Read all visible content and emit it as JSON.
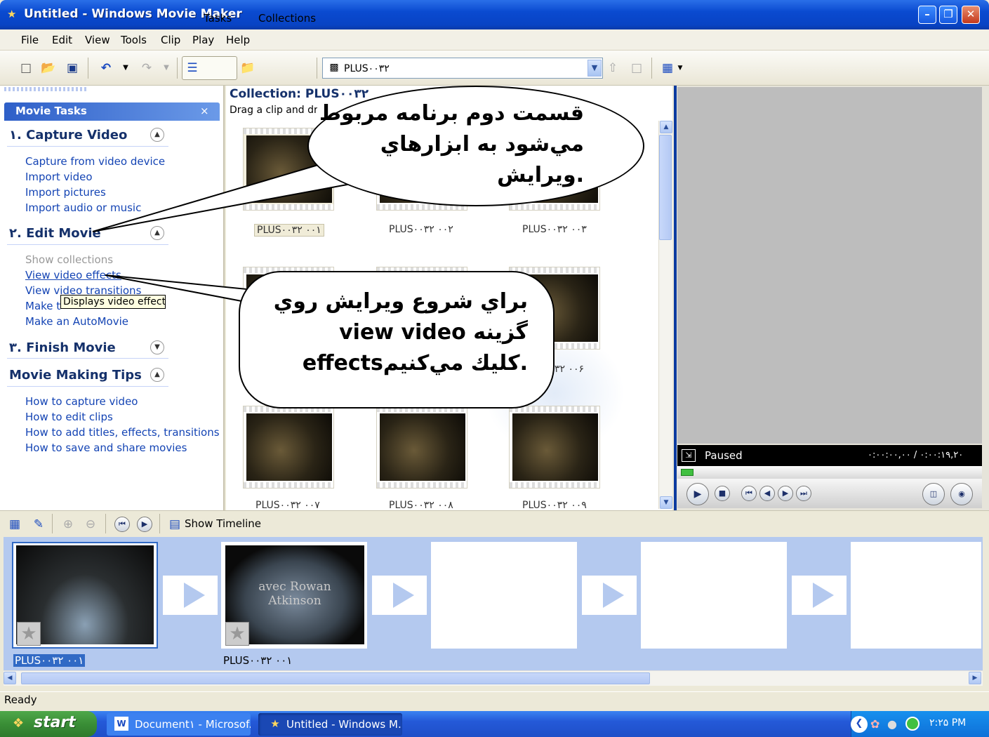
{
  "window": {
    "title": "Untitled - Windows Movie Maker",
    "min": "–",
    "max": "❐",
    "close": "✕"
  },
  "menu": [
    "File",
    "Edit",
    "View",
    "Tools",
    "Clip",
    "Play",
    "Help"
  ],
  "toolbar": {
    "tasks": "Tasks",
    "collections": "Collections",
    "collection_value": "PLUS۰۰۳۲"
  },
  "taskpane": {
    "header": "Movie Tasks",
    "close": "×",
    "sections": [
      {
        "title": "۱. Capture Video",
        "links": [
          "Capture from video device",
          "Import video",
          "Import pictures",
          "Import audio or music"
        ]
      },
      {
        "title": "۲. Edit Movie",
        "links": [
          "Show collections",
          "View video effects",
          "View video transitions",
          "Make titles or credits",
          "Make an AutoMovie"
        ]
      },
      {
        "title": "۳. Finish Movie",
        "links": []
      },
      {
        "title": "Movie Making Tips",
        "links": [
          "How to capture video",
          "How to edit clips",
          "How to add titles, effects, transitions",
          "How to save and share movies"
        ]
      }
    ],
    "tooltip": "Displays video effects"
  },
  "collection": {
    "title": "Collection: PLUS۰۰۳۲",
    "hint": "Drag a clip and drop it on the storyboard below.",
    "clips": [
      "PLUS۰۰۳۲ ۰۰۱",
      "PLUS۰۰۳۲ ۰۰۲",
      "PLUS۰۰۳۲ ۰۰۳",
      "۳۲ ۰۰۶",
      "PLUS۰۰۳۲ ۰۰۷",
      "PLUS۰۰۳۲ ۰۰۸",
      "PLUS۰۰۳۲ ۰۰۹"
    ]
  },
  "monitor": {
    "status": "Paused",
    "timecode": "۰:۰۰:۰۰,۰۰ / ۰:۰۰:۱۹,۲۰"
  },
  "storyboard": {
    "show_timeline": "Show Timeline",
    "clips": [
      "PLUS۰۰۳۲ ۰۰۱",
      "PLUS۰۰۳۲ ۰۰۱"
    ],
    "clip2_overlay": "avec Rowan Atkinson"
  },
  "statusbar": "Ready",
  "taskbar": {
    "start": "start",
    "tasks": [
      "Document۱ - Microsof...",
      "Untitled - Windows M..."
    ],
    "clock": "۲:۲۵ PM"
  },
  "callouts": {
    "top": [
      "قسمت دوم برنامه مربوط",
      "مي‌شود به ابزارهاي",
      "ويرايش."
    ],
    "bottom": [
      "براي شروع ويرايش روي",
      "view video  گزينه",
      "effectsكليك مي‌كنيم."
    ]
  },
  "colors": {
    "titlebar": "#0a4ad0",
    "link": "#1444b4",
    "storyboard": "#b4c9ef",
    "start": "#3a8e36"
  }
}
